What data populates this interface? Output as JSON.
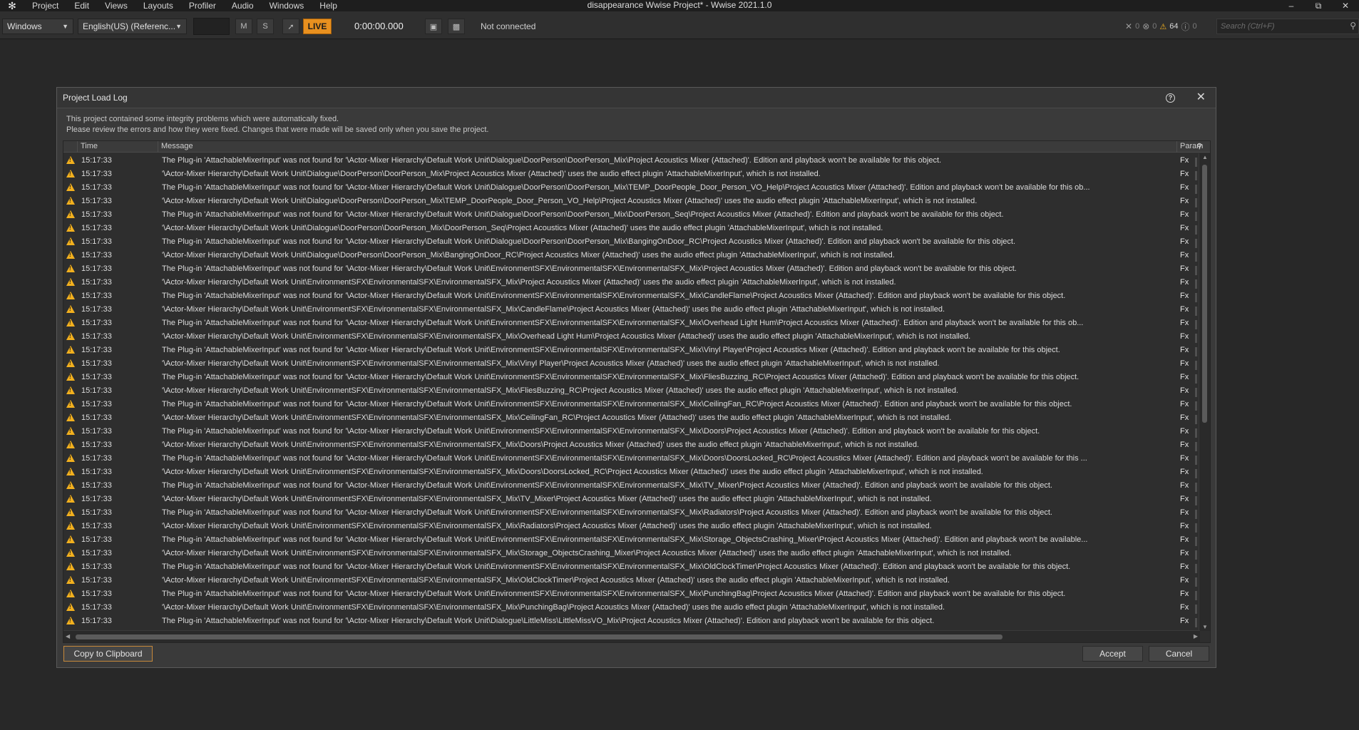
{
  "menubar": {
    "items": [
      "Project",
      "Edit",
      "Views",
      "Layouts",
      "Profiler",
      "Audio",
      "Windows",
      "Help"
    ],
    "window_title": "disappearance Wwise Project* - Wwise 2021.1.0"
  },
  "toolbar": {
    "platform": "Windows",
    "language": "English(US) (Referenc...",
    "mute_label": "M",
    "solo_label": "S",
    "live_label": "LIVE",
    "timecode": "0:00:00.000",
    "connection_status": "Not connected",
    "notif_error_count": "0",
    "notif_fatal_count": "0",
    "notif_warning_count": "64",
    "notif_info_count": "0",
    "search_placeholder": "Search (Ctrl+F)"
  },
  "colors": {
    "accent": "#e8901f",
    "warning": "#f2b01e",
    "background": "#282828",
    "dialog": "#3a3a3a"
  },
  "dialog": {
    "title": "Project Load Log",
    "intro_line1": "This project contained some integrity problems which were automatically fixed.",
    "intro_line2": "Please review the errors and how they were fixed. Changes that were made will be saved only when you save the project.",
    "columns": {
      "time": "Time",
      "message": "Message",
      "param": "Param"
    },
    "buttons": {
      "copy": "Copy to Clipboard",
      "accept": "Accept",
      "cancel": "Cancel"
    },
    "rows": [
      {
        "time": "15:17:33",
        "message": "The Plug-in 'AttachableMixerInput' was not found for '\\Actor-Mixer Hierarchy\\Default Work Unit\\Dialogue\\DoorPerson\\DoorPerson_Mix\\Project Acoustics Mixer (Attached)'. Edition and playback won't be available for this object.",
        "fx": "Fx"
      },
      {
        "time": "15:17:33",
        "message": "'\\Actor-Mixer Hierarchy\\Default Work Unit\\Dialogue\\DoorPerson\\DoorPerson_Mix\\Project Acoustics Mixer (Attached)' uses the audio effect plugin 'AttachableMixerInput', which is not installed.",
        "fx": "Fx"
      },
      {
        "time": "15:17:33",
        "message": "The Plug-in 'AttachableMixerInput' was not found for '\\Actor-Mixer Hierarchy\\Default Work Unit\\Dialogue\\DoorPerson\\DoorPerson_Mix\\TEMP_DoorPeople_Door_Person_VO_Help\\Project Acoustics Mixer (Attached)'. Edition and playback won't be available for this ob...",
        "fx": "Fx"
      },
      {
        "time": "15:17:33",
        "message": "'\\Actor-Mixer Hierarchy\\Default Work Unit\\Dialogue\\DoorPerson\\DoorPerson_Mix\\TEMP_DoorPeople_Door_Person_VO_Help\\Project Acoustics Mixer (Attached)' uses the audio effect plugin 'AttachableMixerInput', which is not installed.",
        "fx": "Fx"
      },
      {
        "time": "15:17:33",
        "message": "The Plug-in 'AttachableMixerInput' was not found for '\\Actor-Mixer Hierarchy\\Default Work Unit\\Dialogue\\DoorPerson\\DoorPerson_Mix\\DoorPerson_Seq\\Project Acoustics Mixer (Attached)'. Edition and playback won't be available for this object.",
        "fx": "Fx"
      },
      {
        "time": "15:17:33",
        "message": "'\\Actor-Mixer Hierarchy\\Default Work Unit\\Dialogue\\DoorPerson\\DoorPerson_Mix\\DoorPerson_Seq\\Project Acoustics Mixer (Attached)' uses the audio effect plugin 'AttachableMixerInput', which is not installed.",
        "fx": "Fx"
      },
      {
        "time": "15:17:33",
        "message": "The Plug-in 'AttachableMixerInput' was not found for '\\Actor-Mixer Hierarchy\\Default Work Unit\\Dialogue\\DoorPerson\\DoorPerson_Mix\\BangingOnDoor_RC\\Project Acoustics Mixer (Attached)'. Edition and playback won't be available for this object.",
        "fx": "Fx"
      },
      {
        "time": "15:17:33",
        "message": "'\\Actor-Mixer Hierarchy\\Default Work Unit\\Dialogue\\DoorPerson\\DoorPerson_Mix\\BangingOnDoor_RC\\Project Acoustics Mixer (Attached)' uses the audio effect plugin 'AttachableMixerInput', which is not installed.",
        "fx": "Fx"
      },
      {
        "time": "15:17:33",
        "message": "The Plug-in 'AttachableMixerInput' was not found for '\\Actor-Mixer Hierarchy\\Default Work Unit\\EnvironmentSFX\\EnvironmentalSFX\\EnvironmentalSFX_Mix\\Project Acoustics Mixer (Attached)'. Edition and playback won't be available for this object.",
        "fx": "Fx"
      },
      {
        "time": "15:17:33",
        "message": "'\\Actor-Mixer Hierarchy\\Default Work Unit\\EnvironmentSFX\\EnvironmentalSFX\\EnvironmentalSFX_Mix\\Project Acoustics Mixer (Attached)' uses the audio effect plugin 'AttachableMixerInput', which is not installed.",
        "fx": "Fx"
      },
      {
        "time": "15:17:33",
        "message": "The Plug-in 'AttachableMixerInput' was not found for '\\Actor-Mixer Hierarchy\\Default Work Unit\\EnvironmentSFX\\EnvironmentalSFX\\EnvironmentalSFX_Mix\\CandleFlame\\Project Acoustics Mixer (Attached)'. Edition and playback won't be available for this object.",
        "fx": "Fx"
      },
      {
        "time": "15:17:33",
        "message": "'\\Actor-Mixer Hierarchy\\Default Work Unit\\EnvironmentSFX\\EnvironmentalSFX\\EnvironmentalSFX_Mix\\CandleFlame\\Project Acoustics Mixer (Attached)' uses the audio effect plugin 'AttachableMixerInput', which is not installed.",
        "fx": "Fx"
      },
      {
        "time": "15:17:33",
        "message": "The Plug-in 'AttachableMixerInput' was not found for '\\Actor-Mixer Hierarchy\\Default Work Unit\\EnvironmentSFX\\EnvironmentalSFX\\EnvironmentalSFX_Mix\\Overhead Light Hum\\Project Acoustics Mixer (Attached)'. Edition and playback won't be available for this ob...",
        "fx": "Fx"
      },
      {
        "time": "15:17:33",
        "message": "'\\Actor-Mixer Hierarchy\\Default Work Unit\\EnvironmentSFX\\EnvironmentalSFX\\EnvironmentalSFX_Mix\\Overhead Light Hum\\Project Acoustics Mixer (Attached)' uses the audio effect plugin 'AttachableMixerInput', which is not installed.",
        "fx": "Fx"
      },
      {
        "time": "15:17:33",
        "message": "The Plug-in 'AttachableMixerInput' was not found for '\\Actor-Mixer Hierarchy\\Default Work Unit\\EnvironmentSFX\\EnvironmentalSFX\\EnvironmentalSFX_Mix\\Vinyl Player\\Project Acoustics Mixer (Attached)'. Edition and playback won't be available for this object.",
        "fx": "Fx"
      },
      {
        "time": "15:17:33",
        "message": "'\\Actor-Mixer Hierarchy\\Default Work Unit\\EnvironmentSFX\\EnvironmentalSFX\\EnvironmentalSFX_Mix\\Vinyl Player\\Project Acoustics Mixer (Attached)' uses the audio effect plugin 'AttachableMixerInput', which is not installed.",
        "fx": "Fx"
      },
      {
        "time": "15:17:33",
        "message": "The Plug-in 'AttachableMixerInput' was not found for '\\Actor-Mixer Hierarchy\\Default Work Unit\\EnvironmentSFX\\EnvironmentalSFX\\EnvironmentalSFX_Mix\\FliesBuzzing_RC\\Project Acoustics Mixer (Attached)'. Edition and playback won't be available for this object.",
        "fx": "Fx"
      },
      {
        "time": "15:17:33",
        "message": "'\\Actor-Mixer Hierarchy\\Default Work Unit\\EnvironmentSFX\\EnvironmentalSFX\\EnvironmentalSFX_Mix\\FliesBuzzing_RC\\Project Acoustics Mixer (Attached)' uses the audio effect plugin 'AttachableMixerInput', which is not installed.",
        "fx": "Fx"
      },
      {
        "time": "15:17:33",
        "message": "The Plug-in 'AttachableMixerInput' was not found for '\\Actor-Mixer Hierarchy\\Default Work Unit\\EnvironmentSFX\\EnvironmentalSFX\\EnvironmentalSFX_Mix\\CeilingFan_RC\\Project Acoustics Mixer (Attached)'. Edition and playback won't be available for this object.",
        "fx": "Fx"
      },
      {
        "time": "15:17:33",
        "message": "'\\Actor-Mixer Hierarchy\\Default Work Unit\\EnvironmentSFX\\EnvironmentalSFX\\EnvironmentalSFX_Mix\\CeilingFan_RC\\Project Acoustics Mixer (Attached)' uses the audio effect plugin 'AttachableMixerInput', which is not installed.",
        "fx": "Fx"
      },
      {
        "time": "15:17:33",
        "message": "The Plug-in 'AttachableMixerInput' was not found for '\\Actor-Mixer Hierarchy\\Default Work Unit\\EnvironmentSFX\\EnvironmentalSFX\\EnvironmentalSFX_Mix\\Doors\\Project Acoustics Mixer (Attached)'. Edition and playback won't be available for this object.",
        "fx": "Fx"
      },
      {
        "time": "15:17:33",
        "message": "'\\Actor-Mixer Hierarchy\\Default Work Unit\\EnvironmentSFX\\EnvironmentalSFX\\EnvironmentalSFX_Mix\\Doors\\Project Acoustics Mixer (Attached)' uses the audio effect plugin 'AttachableMixerInput', which is not installed.",
        "fx": "Fx"
      },
      {
        "time": "15:17:33",
        "message": "The Plug-in 'AttachableMixerInput' was not found for '\\Actor-Mixer Hierarchy\\Default Work Unit\\EnvironmentSFX\\EnvironmentalSFX\\EnvironmentalSFX_Mix\\Doors\\DoorsLocked_RC\\Project Acoustics Mixer (Attached)'. Edition and playback won't be available for this ...",
        "fx": "Fx"
      },
      {
        "time": "15:17:33",
        "message": "'\\Actor-Mixer Hierarchy\\Default Work Unit\\EnvironmentSFX\\EnvironmentalSFX\\EnvironmentalSFX_Mix\\Doors\\DoorsLocked_RC\\Project Acoustics Mixer (Attached)' uses the audio effect plugin 'AttachableMixerInput', which is not installed.",
        "fx": "Fx"
      },
      {
        "time": "15:17:33",
        "message": "The Plug-in 'AttachableMixerInput' was not found for '\\Actor-Mixer Hierarchy\\Default Work Unit\\EnvironmentSFX\\EnvironmentalSFX\\EnvironmentalSFX_Mix\\TV_Mixer\\Project Acoustics Mixer (Attached)'. Edition and playback won't be available for this object.",
        "fx": "Fx"
      },
      {
        "time": "15:17:33",
        "message": "'\\Actor-Mixer Hierarchy\\Default Work Unit\\EnvironmentSFX\\EnvironmentalSFX\\EnvironmentalSFX_Mix\\TV_Mixer\\Project Acoustics Mixer (Attached)' uses the audio effect plugin 'AttachableMixerInput', which is not installed.",
        "fx": "Fx"
      },
      {
        "time": "15:17:33",
        "message": "The Plug-in 'AttachableMixerInput' was not found for '\\Actor-Mixer Hierarchy\\Default Work Unit\\EnvironmentSFX\\EnvironmentalSFX\\EnvironmentalSFX_Mix\\Radiators\\Project Acoustics Mixer (Attached)'. Edition and playback won't be available for this object.",
        "fx": "Fx"
      },
      {
        "time": "15:17:33",
        "message": "'\\Actor-Mixer Hierarchy\\Default Work Unit\\EnvironmentSFX\\EnvironmentalSFX\\EnvironmentalSFX_Mix\\Radiators\\Project Acoustics Mixer (Attached)' uses the audio effect plugin 'AttachableMixerInput', which is not installed.",
        "fx": "Fx"
      },
      {
        "time": "15:17:33",
        "message": "The Plug-in 'AttachableMixerInput' was not found for '\\Actor-Mixer Hierarchy\\Default Work Unit\\EnvironmentSFX\\EnvironmentalSFX\\EnvironmentalSFX_Mix\\Storage_ObjectsCrashing_Mixer\\Project Acoustics Mixer (Attached)'. Edition and playback won't be available...",
        "fx": "Fx"
      },
      {
        "time": "15:17:33",
        "message": "'\\Actor-Mixer Hierarchy\\Default Work Unit\\EnvironmentSFX\\EnvironmentalSFX\\EnvironmentalSFX_Mix\\Storage_ObjectsCrashing_Mixer\\Project Acoustics Mixer (Attached)' uses the audio effect plugin 'AttachableMixerInput', which is not installed.",
        "fx": "Fx"
      },
      {
        "time": "15:17:33",
        "message": "The Plug-in 'AttachableMixerInput' was not found for '\\Actor-Mixer Hierarchy\\Default Work Unit\\EnvironmentSFX\\EnvironmentalSFX\\EnvironmentalSFX_Mix\\OldClockTimer\\Project Acoustics Mixer (Attached)'. Edition and playback won't be available for this object.",
        "fx": "Fx"
      },
      {
        "time": "15:17:33",
        "message": "'\\Actor-Mixer Hierarchy\\Default Work Unit\\EnvironmentSFX\\EnvironmentalSFX\\EnvironmentalSFX_Mix\\OldClockTimer\\Project Acoustics Mixer (Attached)' uses the audio effect plugin 'AttachableMixerInput', which is not installed.",
        "fx": "Fx"
      },
      {
        "time": "15:17:33",
        "message": "The Plug-in 'AttachableMixerInput' was not found for '\\Actor-Mixer Hierarchy\\Default Work Unit\\EnvironmentSFX\\EnvironmentalSFX\\EnvironmentalSFX_Mix\\PunchingBag\\Project Acoustics Mixer (Attached)'. Edition and playback won't be available for this object.",
        "fx": "Fx"
      },
      {
        "time": "15:17:33",
        "message": "'\\Actor-Mixer Hierarchy\\Default Work Unit\\EnvironmentSFX\\EnvironmentalSFX\\EnvironmentalSFX_Mix\\PunchingBag\\Project Acoustics Mixer (Attached)' uses the audio effect plugin 'AttachableMixerInput', which is not installed.",
        "fx": "Fx"
      },
      {
        "time": "15:17:33",
        "message": "The Plug-in 'AttachableMixerInput' was not found for '\\Actor-Mixer Hierarchy\\Default Work Unit\\Dialogue\\LittleMiss\\LittleMissVO_Mix\\Project Acoustics Mixer (Attached)'. Edition and playback won't be available for this object.",
        "fx": "Fx"
      }
    ]
  }
}
